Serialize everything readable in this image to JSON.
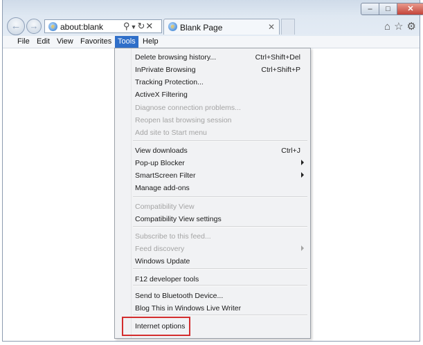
{
  "address_bar": {
    "url": "about:blank"
  },
  "tab": {
    "title": "Blank Page"
  },
  "menu": {
    "file": "File",
    "edit": "Edit",
    "view": "View",
    "favorites": "Favorites",
    "tools": "Tools",
    "help": "Help"
  },
  "tools_menu": {
    "items": [
      {
        "label": "Delete browsing history...",
        "shortcut": "Ctrl+Shift+Del",
        "disabled": false
      },
      {
        "label": "InPrivate Browsing",
        "shortcut": "Ctrl+Shift+P",
        "disabled": false
      },
      {
        "label": "Tracking Protection...",
        "shortcut": "",
        "disabled": false
      },
      {
        "label": "ActiveX Filtering",
        "shortcut": "",
        "disabled": false
      },
      {
        "label": "Diagnose connection problems...",
        "shortcut": "",
        "disabled": true
      },
      {
        "label": "Reopen last browsing session",
        "shortcut": "",
        "disabled": true
      },
      {
        "label": "Add site to Start menu",
        "shortcut": "",
        "disabled": true
      },
      {
        "label": "View downloads",
        "shortcut": "Ctrl+J",
        "disabled": false
      },
      {
        "label": "Pop-up Blocker",
        "shortcut": "",
        "disabled": false,
        "submenu": true
      },
      {
        "label": "SmartScreen Filter",
        "shortcut": "",
        "disabled": false,
        "submenu": true
      },
      {
        "label": "Manage add-ons",
        "shortcut": "",
        "disabled": false
      },
      {
        "label": "Compatibility View",
        "shortcut": "",
        "disabled": true
      },
      {
        "label": "Compatibility View settings",
        "shortcut": "",
        "disabled": false
      },
      {
        "label": "Subscribe to this feed...",
        "shortcut": "",
        "disabled": true
      },
      {
        "label": "Feed discovery",
        "shortcut": "",
        "disabled": true,
        "submenu": true
      },
      {
        "label": "Windows Update",
        "shortcut": "",
        "disabled": false
      },
      {
        "label": "F12 developer tools",
        "shortcut": "",
        "disabled": false
      },
      {
        "label": "Send to Bluetooth Device...",
        "shortcut": "",
        "disabled": false
      },
      {
        "label": "Blog This in Windows Live Writer",
        "shortcut": "",
        "disabled": false
      },
      {
        "label": "Internet options",
        "shortcut": "",
        "disabled": false,
        "highlighted": true
      }
    ]
  },
  "icons": {
    "back": "back-arrow-icon",
    "forward": "forward-arrow-icon",
    "search": "search-icon",
    "refresh": "refresh-icon",
    "stop": "stop-icon",
    "home": "home-icon",
    "favorites": "star-icon",
    "tools": "gear-icon"
  },
  "colors": {
    "menu_highlight": "#2f6fc9",
    "annotation_box": "#d32d2d"
  }
}
